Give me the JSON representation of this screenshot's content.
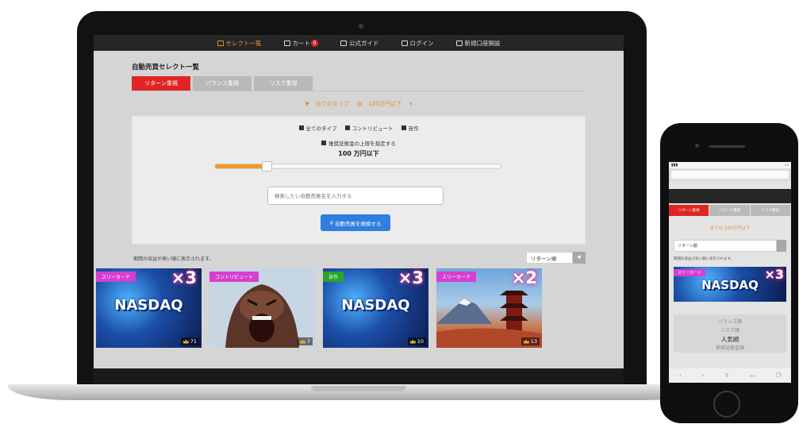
{
  "nav": {
    "items": [
      {
        "label": "セレクト一覧",
        "active": true
      },
      {
        "label": "カート",
        "badge": "0"
      },
      {
        "label": "公式ガイド"
      },
      {
        "label": "ログイン"
      },
      {
        "label": "新規口座開設"
      }
    ]
  },
  "page": {
    "title": "自動売買セレクト一覧",
    "tabs": [
      {
        "label": "リターン重視",
        "active": true
      },
      {
        "label": "バランス重視"
      },
      {
        "label": "リスク重視"
      }
    ],
    "filter_type": "全てのタイプ",
    "filter_price": "100万円以下"
  },
  "filters": {
    "checks": [
      "全てのタイプ",
      "コントリビュート",
      "自作"
    ],
    "limit_check": "推奨証拠金の上限を指定する",
    "price_label": "100 万円以下",
    "slider_fraction": 0.18,
    "search_placeholder": "検索したい自動売買名を入力する",
    "search_button": "自動売買を検索する"
  },
  "results": {
    "note": "期間の収益が高い順に表示されます。",
    "sort_value": "リターン順"
  },
  "cards": [
    {
      "tag": "スリーカード",
      "tag_color": "#d63fd0",
      "mult": "×3",
      "main": "NASDAQ",
      "count": "71",
      "style": "nasdaq"
    },
    {
      "tag": "コントリビュート",
      "tag_color": "#d63fd0",
      "mult": "",
      "main": "",
      "count": "7",
      "style": "gorilla"
    },
    {
      "tag": "自作",
      "tag_color": "#2aa52a",
      "mult": "×3",
      "main": "NASDAQ",
      "count": "10",
      "style": "nasdaq"
    },
    {
      "tag": "スリーカード",
      "tag_color": "#d63fd0",
      "mult": "×2",
      "main": "",
      "count": "13",
      "style": "fuji"
    }
  ],
  "phone": {
    "tabs": [
      "リターン重視",
      "バランス重視",
      "リスク重視"
    ],
    "filter": "全ての 100万円以下",
    "select_value": "リターン順",
    "note": "期間の収益が高い順に表示されます。",
    "card": {
      "tag": "スリーカード",
      "mult": "×3",
      "main": "NASDAQ"
    },
    "dropdown": [
      "バランス順",
      "リスク順",
      "人気順",
      "推奨証拠金順"
    ],
    "dropdown_selected": "人気順"
  }
}
